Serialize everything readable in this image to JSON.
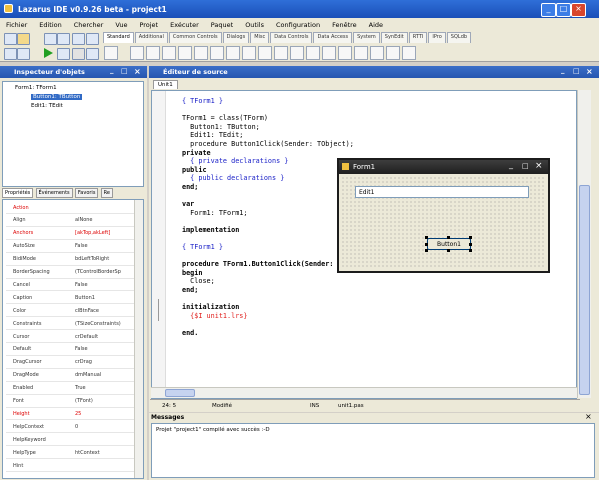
{
  "app": {
    "title": "Lazarus IDE v0.9.26 beta - project1",
    "window_buttons": [
      "_",
      "□",
      "×"
    ]
  },
  "menu": [
    "Fichier",
    "Edition",
    "Chercher",
    "Vue",
    "Projet",
    "Exécuter",
    "Paquet",
    "Outils",
    "Configuration",
    "Fenêtre",
    "Aide"
  ],
  "palette_tabs": [
    "Standard",
    "Additional",
    "Common Controls",
    "Dialogs",
    "Misc",
    "Data Controls",
    "Data Access",
    "System",
    "SynEdit",
    "RTTI",
    "IPro",
    "SQLdb"
  ],
  "inspector": {
    "title": "Inspecteur d'objets",
    "tree": [
      "Form1: TForm1",
      "Button1: TButton",
      "Edit1: TEdit"
    ],
    "tabs": [
      "Propriétés",
      "Événements",
      "Favoris",
      "Re"
    ],
    "properties": [
      {
        "name": "Action",
        "value": "",
        "red": true
      },
      {
        "name": "Align",
        "value": "alNone"
      },
      {
        "name": "Anchors",
        "value": "[akTop,akLeft]",
        "red": true
      },
      {
        "name": "AutoSize",
        "value": "False"
      },
      {
        "name": "BidiMode",
        "value": "bdLeftToRight"
      },
      {
        "name": "BorderSpacing",
        "value": "(TControlBorderSp"
      },
      {
        "name": "Cancel",
        "value": "False"
      },
      {
        "name": "Caption",
        "value": "Button1"
      },
      {
        "name": "Color",
        "value": "clBtnFace"
      },
      {
        "name": "Constraints",
        "value": "(TSizeConstraints)"
      },
      {
        "name": "Cursor",
        "value": "crDefault"
      },
      {
        "name": "Default",
        "value": "False"
      },
      {
        "name": "DragCursor",
        "value": "crDrag"
      },
      {
        "name": "DragMode",
        "value": "dmManual"
      },
      {
        "name": "Enabled",
        "value": "True"
      },
      {
        "name": "Font",
        "value": "(TFont)"
      },
      {
        "name": "Height",
        "value": "25",
        "red": true
      },
      {
        "name": "HelpContext",
        "value": "0"
      },
      {
        "name": "HelpKeyword",
        "value": ""
      },
      {
        "name": "HelpType",
        "value": "htContext"
      },
      {
        "name": "Hint",
        "value": ""
      }
    ]
  },
  "editor": {
    "title": "Éditeur de source",
    "tab": "Unit1",
    "lines": [
      {
        "t": "{ TForm1 }",
        "c": "cm"
      },
      {
        "t": "",
        "c": ""
      },
      {
        "t": "TForm1 = class(TForm)",
        "c": ""
      },
      {
        "t": "  Button1: TButton;",
        "c": ""
      },
      {
        "t": "  Edit1: TEdit;",
        "c": ""
      },
      {
        "t": "  procedure Button1Click(Sender: TObject);",
        "c": ""
      },
      {
        "t": "private",
        "c": "kw"
      },
      {
        "t": "  { private declarations }",
        "c": "cm"
      },
      {
        "t": "public",
        "c": "kw"
      },
      {
        "t": "  { public declarations }",
        "c": "cm"
      },
      {
        "t": "end;",
        "c": "kw"
      },
      {
        "t": "",
        "c": ""
      },
      {
        "t": "var",
        "c": "kw"
      },
      {
        "t": "  Form1: TForm1;",
        "c": ""
      },
      {
        "t": "",
        "c": ""
      },
      {
        "t": "implementation",
        "c": "kw"
      },
      {
        "t": "",
        "c": ""
      },
      {
        "t": "{ TForm1 }",
        "c": "cm"
      },
      {
        "t": "",
        "c": ""
      },
      {
        "t": "procedure TForm1.Button1Click(Sender: TObject);",
        "c": "kw"
      },
      {
        "t": "begin",
        "c": "kw"
      },
      {
        "t": "  Close;",
        "c": ""
      },
      {
        "t": "end;",
        "c": "kw"
      },
      {
        "t": "",
        "c": ""
      },
      {
        "t": "initialization",
        "c": "kw"
      },
      {
        "t": "  {$I unit1.lrs}",
        "c": "rd"
      },
      {
        "t": "",
        "c": ""
      },
      {
        "t": "end.",
        "c": "kw"
      }
    ],
    "status": {
      "pos": "24: 5",
      "mode": "Modifié",
      "ins": "INS",
      "file": "unit1.pas"
    }
  },
  "form": {
    "title": "Form1",
    "edit_value": "Edit1",
    "button_label": "Button1"
  },
  "messages": {
    "title": "Messages",
    "text": "Projet \"project1\" compilé avec succès :-D"
  }
}
